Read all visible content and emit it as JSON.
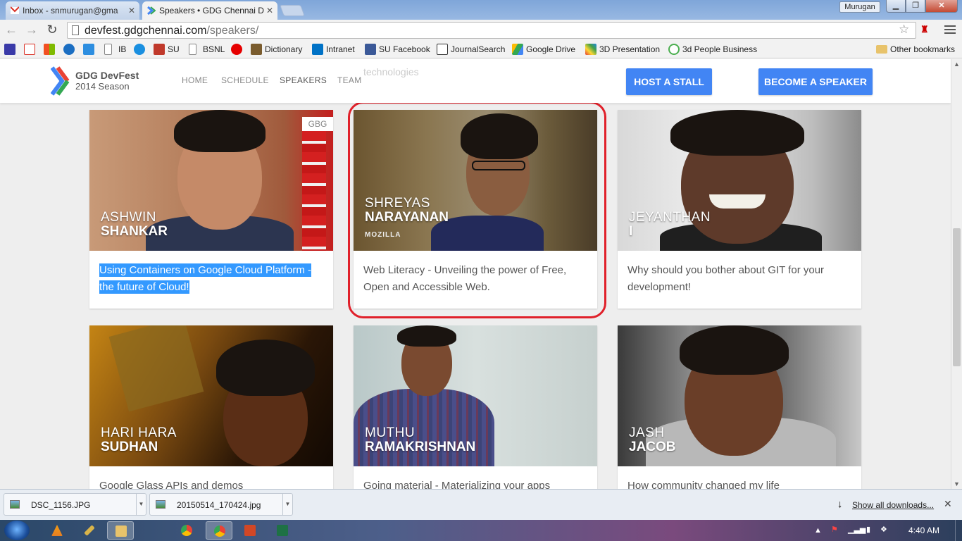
{
  "browser": {
    "tabs": [
      {
        "title": "Inbox - snmurugan@gma",
        "active": false
      },
      {
        "title": "Speakers • GDG Chennai D",
        "active": true
      }
    ],
    "profile_name": "Murugan",
    "url_host": "devfest.gdgchennai.com",
    "url_path": "/speakers/",
    "bookmarks": [
      {
        "label": "IB"
      },
      {
        "label": "SU"
      },
      {
        "label": "BSNL"
      },
      {
        "label": "Dictionary"
      },
      {
        "label": "Intranet"
      },
      {
        "label": "SU Facebook"
      },
      {
        "label": "JournalSearch"
      },
      {
        "label": "Google Drive"
      },
      {
        "label": "3D Presentation"
      },
      {
        "label": "3d People Business"
      }
    ],
    "other_bookmarks": "Other bookmarks"
  },
  "site": {
    "logo_title": "GDG DevFest",
    "logo_subtitle": "2014 Season",
    "nav": [
      "HOME",
      "SCHEDULE",
      "SPEAKERS",
      "TEAM"
    ],
    "active_nav": "SPEAKERS",
    "ghost_text": "technologies",
    "host_stall": "HOST A STALL",
    "become_speaker": "BECOME A SPEAKER"
  },
  "speakers": [
    {
      "first": "ASHWIN",
      "last": "SHANKAR",
      "org": "",
      "badge": "GBG",
      "talk": "Using Containers on Google Cloud Platform - the future of Cloud!",
      "selected": true
    },
    {
      "first": "SHREYAS",
      "last": "NARAYANAN",
      "org": "MOZILLA",
      "badge": "",
      "talk": "Web Literacy - Unveiling the power of Free, Open and Accessible Web.",
      "highlighted": true
    },
    {
      "first": "JEYANTHAN",
      "last": "I",
      "org": "",
      "badge": "",
      "talk": "Why should you bother about GIT for your development!"
    },
    {
      "first": "HARI HARA",
      "last": "SUDHAN",
      "org": "",
      "badge": "",
      "talk": "Google Glass APIs and demos"
    },
    {
      "first": "MUTHU",
      "last": "RAMAKRISHNAN",
      "org": "",
      "badge": "",
      "talk": "Going material - Materializing your apps"
    },
    {
      "first": "JASH",
      "last": "JACOB",
      "org": "",
      "badge": "",
      "talk": "How community changed my life"
    }
  ],
  "downloads": {
    "items": [
      "DSC_1156.JPG",
      "20150514_170424.jpg"
    ],
    "show_all": "Show all downloads..."
  },
  "taskbar": {
    "clock": "4:40 AM"
  },
  "colors": {
    "accent_blue": "#4285f4",
    "highlight_red": "#e0202a",
    "selection_blue": "#3399ff"
  }
}
